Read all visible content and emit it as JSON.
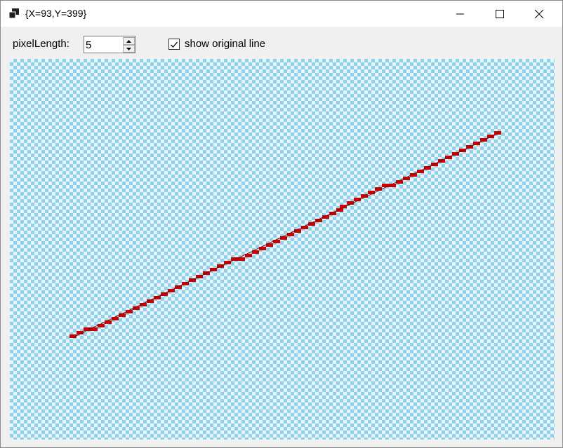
{
  "window": {
    "title": "{X=93,Y=399}",
    "icons": [
      "app-icon",
      "minimize-icon",
      "maximize-icon",
      "close-icon"
    ]
  },
  "toolbar": {
    "pixel_length_label": "pixelLength:",
    "pixel_length_value": "5",
    "show_original_label": "show original line",
    "show_original_checked": true
  },
  "canvas": {
    "checker_color": "#8fd0ea",
    "background_color": "#e8f6fb",
    "line_color": "#cc0000",
    "pixel_length": 5
  }
}
